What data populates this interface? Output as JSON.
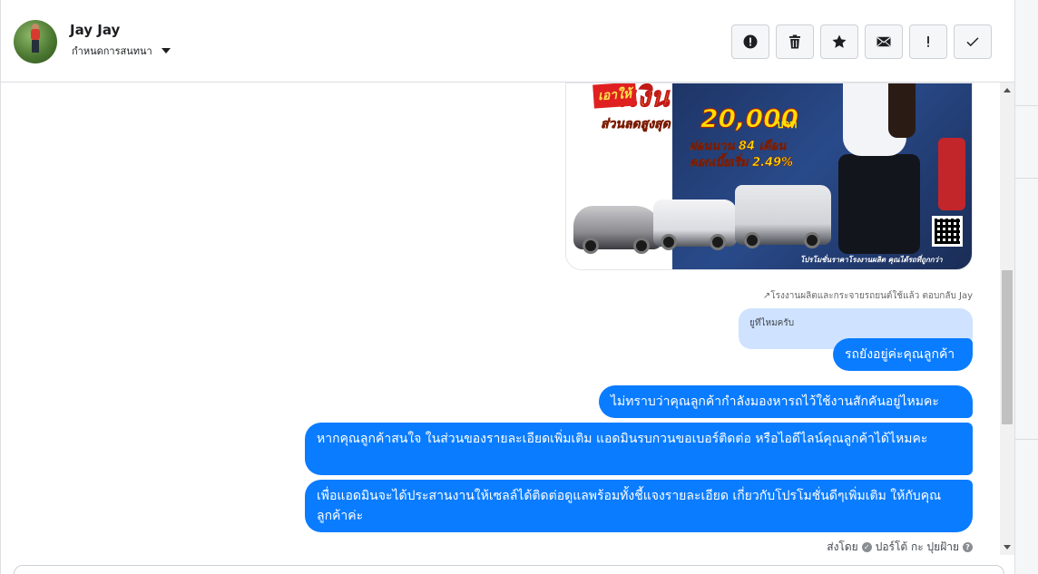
{
  "header": {
    "contact_name": "Jay Jay",
    "assign_label": "กำหนดการสนทนา",
    "actions": [
      {
        "name": "report-button",
        "icon": "exclamation-circle-icon"
      },
      {
        "name": "delete-button",
        "icon": "trash-icon"
      },
      {
        "name": "star-button",
        "icon": "star-icon"
      },
      {
        "name": "mark-unread-button",
        "icon": "envelope-icon"
      },
      {
        "name": "important-button",
        "icon": "exclamation-icon"
      },
      {
        "name": "mark-done-button",
        "icon": "check-icon"
      }
    ]
  },
  "ad_image": {
    "badge": "เอาให้",
    "title": "พรีเงิน",
    "discount_label": "ส่วนลดสูงสุด",
    "discount_amount": "20,000",
    "discount_unit": "บาท",
    "installment": "ผ่อนนาน 84 เดือน",
    "interest": "ดอกเบี้ยเริ่ม 2.49%",
    "footer": "โปรโมชั่นราคาโรงงานผลิต คุณได้รถที่ถูกกว่า"
  },
  "reply_meta": "↗โรงงานผลิตและกระจายรถยนต์ใช้แล้ว ตอบกลับ Jay",
  "quoted_message": "ยูทีไหมครับ",
  "messages": [
    "รถยังอยู่ค่ะคุณลูกค้า",
    "ไม่ทราบว่าคุณลูกค้ากำลังมองหารถไว้ใช้งานสักคันอยู่ไหมคะ",
    "หากคุณลูกค้าสนใจ ในส่วนของรายละเอียดเพิ่มเติม แอดมินรบกวนขอเบอร์ติดต่อ หรือไอดีไลน์คุณลูกค้าได้ไหมคะ",
    "เพื่อแอดมินจะได้ประสานงานให้เซลล์ได้ติดต่อดูแลพร้อมทั้งชี้แจงรายละเอียด เกี่ยวกับโปรโมชั่นดีๆเพิ่มเติม ให้กับคุณลูกค้าค่ะ"
  ],
  "sender": {
    "prefix": "ส่งโดย",
    "name": "ปอร์โต้ กะ ปุยฝ้าย"
  },
  "colors": {
    "bubble": "#0a7cff",
    "quoted": "#cfe2ff"
  }
}
